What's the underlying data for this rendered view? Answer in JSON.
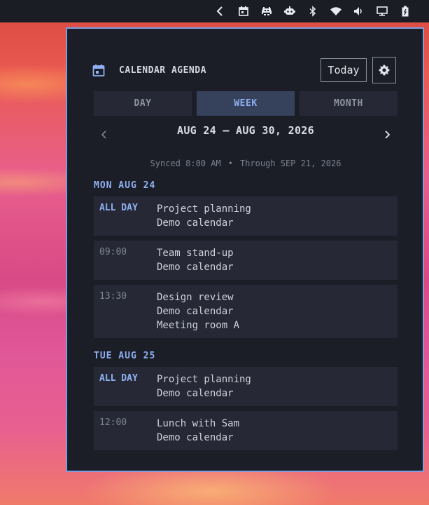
{
  "topbar": {
    "icons": [
      "chevron-left-icon",
      "calendar-icon",
      "space-invader-icon",
      "robot-icon",
      "bluetooth-icon",
      "wifi-icon",
      "volume-icon",
      "monitor-icon",
      "battery-icon"
    ]
  },
  "panel": {
    "title": "CALENDAR AGENDA",
    "today_label": "Today",
    "tabs": [
      {
        "label": "DAY",
        "active": false
      },
      {
        "label": "WEEK",
        "active": true
      },
      {
        "label": "MONTH",
        "active": false
      }
    ],
    "range_label": "AUG 24 – AUG 30, 2026",
    "synced": "Synced 8:00 AM",
    "separator": "•",
    "through": "Through SEP 21, 2026",
    "days": [
      {
        "header": "MON AUG 24",
        "events": [
          {
            "time": "ALL DAY",
            "allday": true,
            "lines": [
              "Project planning",
              "Demo calendar"
            ]
          },
          {
            "time": "09:00",
            "allday": false,
            "lines": [
              "Team stand-up",
              "Demo calendar"
            ]
          },
          {
            "time": "13:30",
            "allday": false,
            "lines": [
              "Design review",
              "Demo calendar",
              "Meeting room A"
            ]
          }
        ]
      },
      {
        "header": "TUE AUG 25",
        "events": [
          {
            "time": "ALL DAY",
            "allday": true,
            "lines": [
              "Project planning",
              "Demo calendar"
            ]
          },
          {
            "time": "12:00",
            "allday": false,
            "lines": [
              "Lunch with Sam",
              "Demo calendar"
            ]
          }
        ]
      }
    ]
  },
  "colors": {
    "accent": "#8fb0f2",
    "panel_bg": "#1c1e27",
    "card_bg": "#262935",
    "border": "#7f9ee0"
  }
}
